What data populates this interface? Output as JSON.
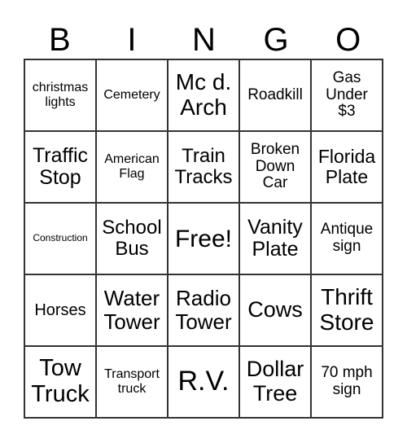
{
  "header": [
    "B",
    "I",
    "N",
    "G",
    "O"
  ],
  "cells": [
    "christmas\nlights",
    "Cemetery",
    "Mc d.\nArch",
    "Roadkill",
    "Gas\nUnder\n$3",
    "Traffic\nStop",
    "American\nFlag",
    "Train\nTracks",
    "Broken\nDown\nCar",
    "Florida\nPlate",
    "Construction",
    "School\nBus",
    "Free!",
    "Vanity\nPlate",
    "Antique\nsign",
    "Horses",
    "Water\nTower",
    "Radio\nTower",
    "Cows",
    "Thrift\nStore",
    "Tow\nTruck",
    "Transport\ntruck",
    "R.V.",
    "Dollar\nTree",
    "70 mph\nsign"
  ]
}
